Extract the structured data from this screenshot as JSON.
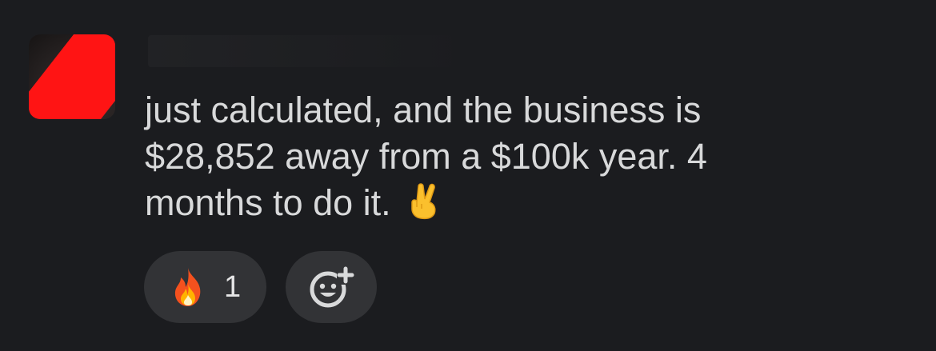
{
  "message": {
    "lines": [
      "just calculated, and the business is",
      "$28,852 away from a $100k year. 4",
      "months to do it."
    ],
    "trailing_emoji": "crossed-fingers"
  },
  "reactions": [
    {
      "emoji": "fire",
      "count": "1"
    }
  ],
  "add_reaction_icon": "add-emoji-icon",
  "colors": {
    "background": "#1b1c1f",
    "text": "#d8d9da",
    "pill": "#323336",
    "redaction": "#ff1414"
  }
}
